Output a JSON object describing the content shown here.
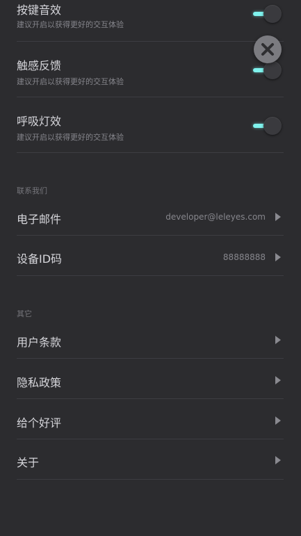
{
  "settings": {
    "toggles": [
      {
        "title": "按键音效",
        "subtitle": "建议开启以获得更好的交互体验",
        "on": true
      },
      {
        "title": "触感反馈",
        "subtitle": "建议开启以获得更好的交互体验",
        "on": true
      },
      {
        "title": "呼吸灯效",
        "subtitle": "建议开启以获得更好的交互体验",
        "on": true
      }
    ]
  },
  "contact": {
    "header": "联系我们",
    "items": [
      {
        "label": "电子邮件",
        "value": "developer@leleyes.com"
      },
      {
        "label": "设备ID码",
        "value": "88888888"
      }
    ]
  },
  "other": {
    "header": "其它",
    "items": [
      {
        "label": "用户条款"
      },
      {
        "label": "隐私政策"
      },
      {
        "label": "给个好评"
      },
      {
        "label": "关于"
      }
    ]
  },
  "icons": {
    "close": "close-icon",
    "chevron": "chevron-right-icon"
  },
  "colors": {
    "background": "#2c2c2f",
    "toggle_accent": "#7ff3ee",
    "divider": "#3d3d42"
  }
}
